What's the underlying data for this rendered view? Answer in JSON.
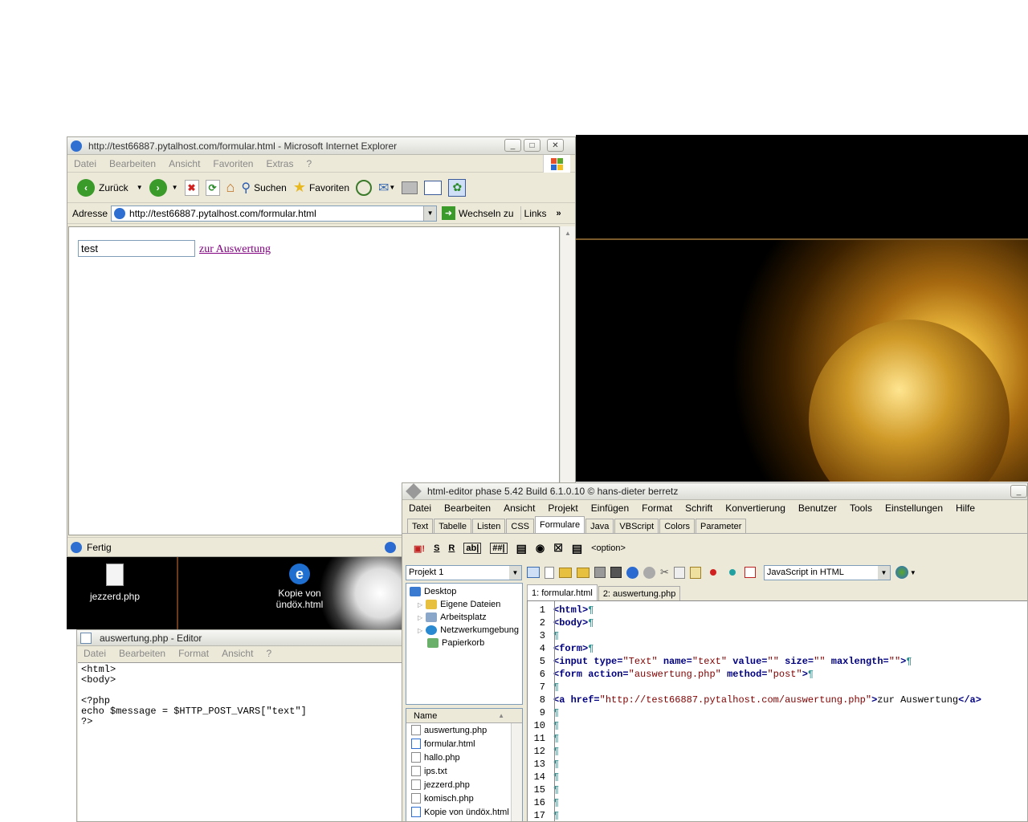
{
  "ie": {
    "title": "http://test66887.pytalhost.com/formular.html - Microsoft Internet Explorer",
    "menu": [
      "Datei",
      "Bearbeiten",
      "Ansicht",
      "Favoriten",
      "Extras",
      "?"
    ],
    "back_label": "Zurück",
    "search_label": "Suchen",
    "favorites_label": "Favoriten",
    "address_label": "Adresse",
    "address_value": "http://test66887.pytalhost.com/formular.html",
    "go_label": "Wechseln zu",
    "links_label": "Links",
    "input_value": "test",
    "link_text": "zur Auswertung",
    "status": "Fertig"
  },
  "desktop": {
    "icon1": "jezzerd.php",
    "icon2_line1": "Kopie von",
    "icon2_line2": "ündöx.html"
  },
  "notepad": {
    "title": "auswertung.php - Editor",
    "menu": [
      "Datei",
      "Bearbeiten",
      "Format",
      "Ansicht",
      "?"
    ],
    "content": "<html>\n<body>\n\n<?php\necho $message = $HTTP_POST_VARS[\"text\"]\n?>"
  },
  "editor": {
    "title": "html-editor phase 5.42 Build 6.1.0.10  ©  hans-dieter berretz",
    "menu": [
      "Datei",
      "Bearbeiten",
      "Ansicht",
      "Projekt",
      "Einfügen",
      "Format",
      "Schrift",
      "Konvertierung",
      "Benutzer",
      "Tools",
      "Einstellungen",
      "Hilfe"
    ],
    "tabs": [
      "Text",
      "Tabelle",
      "Listen",
      "CSS",
      "Formulare",
      "Java",
      "VBScript",
      "Colors",
      "Parameter"
    ],
    "active_tab": "Formulare",
    "option_label": "<option>",
    "project_select": "Projekt 1",
    "script_select": "JavaScript in HTML",
    "tree": [
      "Desktop",
      "Eigene Dateien",
      "Arbeitsplatz",
      "Netzwerkumgebung",
      "Papierkorb"
    ],
    "files_header": "Name",
    "files": [
      "auswertung.php",
      "formular.html",
      "hallo.php",
      "ips.txt",
      "jezzerd.php",
      "komisch.php",
      "Kopie von ündöx.html"
    ],
    "doc_tabs": [
      "1: formular.html",
      "2: auswertung.php"
    ],
    "line_numbers": [
      "1",
      "2",
      "3",
      "4",
      "5",
      "6",
      "7",
      "8",
      "9",
      "10",
      "11",
      "12",
      "13",
      "14",
      "15",
      "16",
      "17"
    ]
  }
}
